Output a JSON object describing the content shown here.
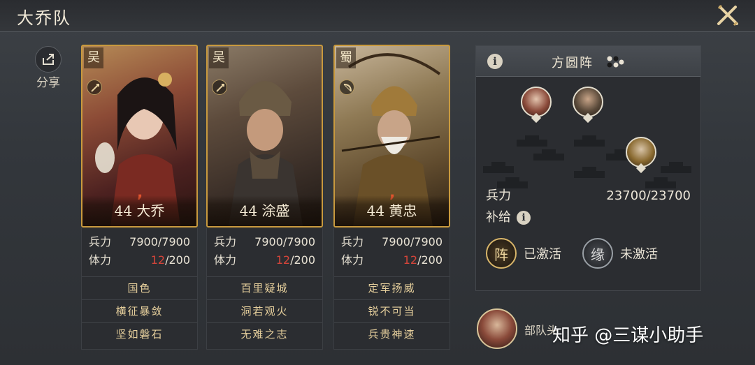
{
  "header": {
    "title": "大乔队"
  },
  "share": {
    "label": "分享"
  },
  "cards": [
    {
      "faction": "吴",
      "level_name": "44 大乔",
      "troops_label": "兵力",
      "troops_value": "7900/7900",
      "stamina_label": "体力",
      "stamina_current": "12",
      "stamina_max": "/200",
      "skills": [
        "国色",
        "横征暴敛",
        "坚如磐石"
      ]
    },
    {
      "faction": "吴",
      "level_name": "44 涂盛",
      "troops_label": "兵力",
      "troops_value": "7900/7900",
      "stamina_label": "体力",
      "stamina_current": "12",
      "stamina_max": "/200",
      "skills": [
        "百里疑城",
        "洞若观火",
        "无难之志"
      ]
    },
    {
      "faction": "蜀",
      "level_name": "44 黄忠",
      "troops_label": "兵力",
      "troops_value": "7900/7900",
      "stamina_label": "体力",
      "stamina_current": "12",
      "stamina_max": "/200",
      "skills": [
        "定军扬威",
        "锐不可当",
        "兵贵神速"
      ]
    }
  ],
  "formation": {
    "name": "方圆阵",
    "troops_label": "兵力",
    "troops_value": "23700/23700",
    "supply_label": "补给",
    "formation_badge": "阵",
    "formation_status": "已激活",
    "bond_badge": "缘",
    "bond_status": "未激活"
  },
  "army": {
    "label": "部队头"
  },
  "watermark": "知乎 @三谋小助手",
  "colors": {
    "gold_border": "#c99a3e",
    "stamina_red": "#d6453a",
    "skill_text": "#e6cf9c"
  }
}
